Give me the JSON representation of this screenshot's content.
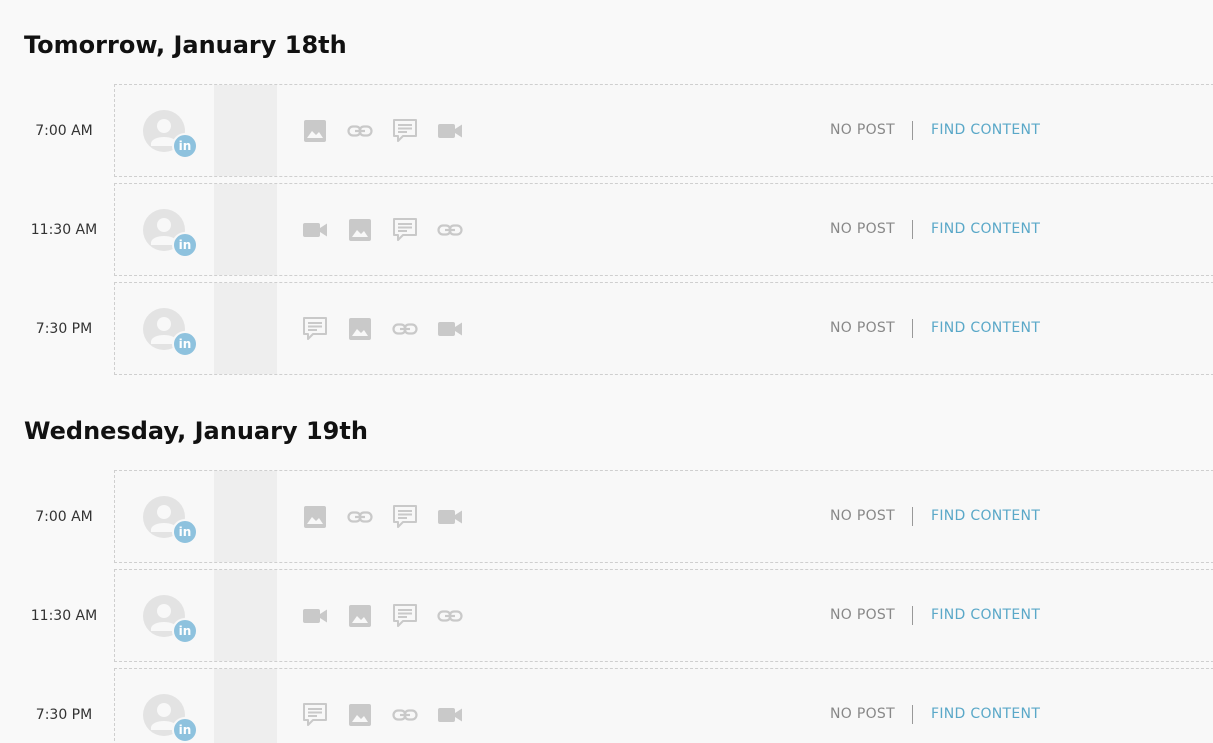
{
  "days": [
    {
      "title": "Tomorrow, January 18th",
      "slots": [
        {
          "time": "7:00 AM",
          "icons": [
            "image-icon",
            "link-icon",
            "comment-icon",
            "video-icon"
          ],
          "status": "NO POST",
          "action": "FIND CONTENT"
        },
        {
          "time": "11:30 AM",
          "icons": [
            "video-icon",
            "image-icon",
            "comment-icon",
            "link-icon"
          ],
          "status": "NO POST",
          "action": "FIND CONTENT"
        },
        {
          "time": "7:30 PM",
          "icons": [
            "comment-icon",
            "image-icon",
            "link-icon",
            "video-icon"
          ],
          "status": "NO POST",
          "action": "FIND CONTENT"
        }
      ]
    },
    {
      "title": "Wednesday, January 19th",
      "slots": [
        {
          "time": "7:00 AM",
          "icons": [
            "image-icon",
            "link-icon",
            "comment-icon",
            "video-icon"
          ],
          "status": "NO POST",
          "action": "FIND CONTENT"
        },
        {
          "time": "11:30 AM",
          "icons": [
            "video-icon",
            "image-icon",
            "comment-icon",
            "link-icon"
          ],
          "status": "NO POST",
          "action": "FIND CONTENT"
        },
        {
          "time": "7:30 PM",
          "icons": [
            "comment-icon",
            "image-icon",
            "link-icon",
            "video-icon"
          ],
          "status": "NO POST",
          "action": "FIND CONTENT"
        }
      ]
    }
  ],
  "social_badge": "in",
  "colors": {
    "icon": "#c9c9c9",
    "link_text": "#5aa8c8",
    "badge": "#8ec2de",
    "status_text": "#888888"
  }
}
